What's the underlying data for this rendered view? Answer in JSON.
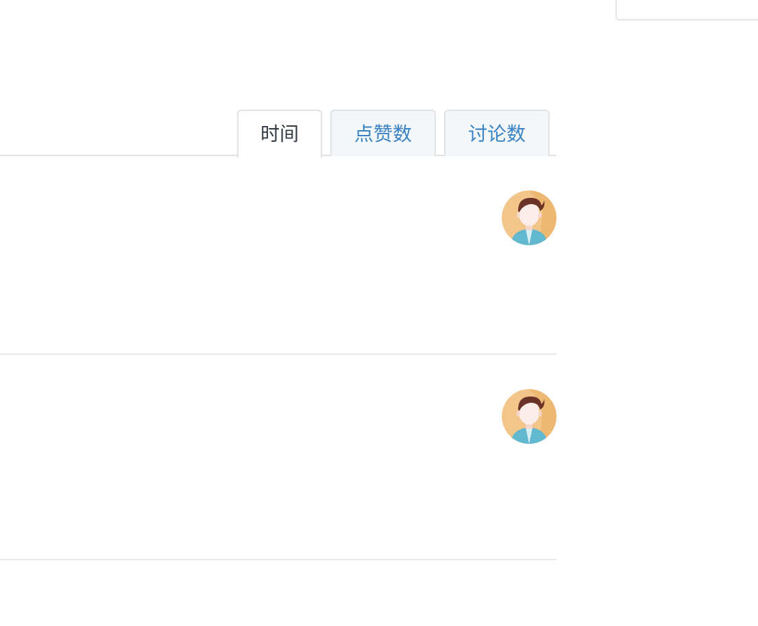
{
  "sort_tabs": {
    "active": "time",
    "items": [
      {
        "id": "time",
        "label": "时间"
      },
      {
        "id": "likes",
        "label": "点赞数"
      },
      {
        "id": "discussions",
        "label": "讨论数"
      }
    ]
  },
  "feed": {
    "items": [
      {
        "avatar_icon": "user-avatar-icon"
      },
      {
        "avatar_icon": "user-avatar-icon"
      }
    ]
  },
  "colors": {
    "tab_link": "#3a83c4",
    "tab_active_text": "#333b45",
    "border": "#dfe3e6",
    "avatar_bg": "#f2c68b"
  }
}
